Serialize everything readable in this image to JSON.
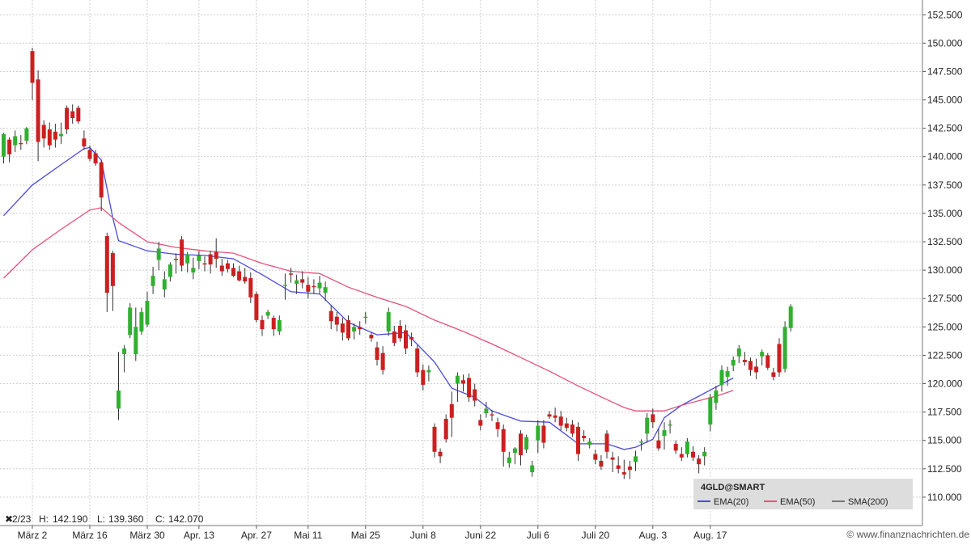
{
  "chart_data": {
    "type": "candlestick",
    "symbol": "4GLD@SMART",
    "info_line": {
      "prefix": "2/23",
      "high_label": "H:",
      "high": "142.190",
      "low_label": "L:",
      "low": "139.360",
      "close_label": "C:",
      "close": "142.070"
    },
    "y_axis": {
      "min": 107.5,
      "max": 153.8,
      "ticks": [
        "152.500",
        "150.000",
        "147.500",
        "145.000",
        "142.500",
        "140.000",
        "137.500",
        "135.000",
        "132.500",
        "130.000",
        "127.500",
        "125.000",
        "122.500",
        "120.000",
        "117.500",
        "115.000",
        "112.500",
        "110.000"
      ]
    },
    "x_ticks": [
      {
        "label": "März 2",
        "index": 5
      },
      {
        "label": "März 16",
        "index": 15
      },
      {
        "label": "März 30",
        "index": 25
      },
      {
        "label": "Apr. 13",
        "index": 34
      },
      {
        "label": "Apr. 27",
        "index": 44
      },
      {
        "label": "Mai 11",
        "index": 53
      },
      {
        "label": "Mai 25",
        "index": 63
      },
      {
        "label": "Juni 8",
        "index": 73
      },
      {
        "label": "Juni 22",
        "index": 83
      },
      {
        "label": "Juli 6",
        "index": 93
      },
      {
        "label": "Juli 20",
        "index": 103
      },
      {
        "label": "Aug. 3",
        "index": 113
      },
      {
        "label": "Aug. 17",
        "index": 123
      }
    ],
    "candles": [
      [
        140.0,
        142.1,
        139.4,
        142.0
      ],
      [
        141.5,
        141.7,
        139.5,
        140.2
      ],
      [
        141.0,
        142.3,
        140.4,
        141.8
      ],
      [
        141.2,
        141.9,
        140.6,
        141.1
      ],
      [
        141.4,
        142.6,
        141.1,
        142.5
      ],
      [
        149.3,
        149.6,
        145.0,
        146.5
      ],
      [
        146.8,
        147.6,
        139.6,
        141.3
      ],
      [
        142.8,
        143.2,
        140.8,
        141.6
      ],
      [
        142.4,
        143.0,
        140.6,
        141.0
      ],
      [
        142.2,
        142.9,
        140.8,
        141.5
      ],
      [
        141.8,
        143.0,
        141.1,
        142.0
      ],
      [
        144.3,
        144.5,
        142.0,
        142.4
      ],
      [
        144.0,
        144.6,
        142.9,
        143.4
      ],
      [
        144.3,
        144.5,
        142.9,
        143.1
      ],
      [
        141.6,
        142.3,
        140.6,
        140.9
      ],
      [
        140.6,
        141.0,
        139.6,
        139.8
      ],
      [
        140.3,
        140.6,
        139.2,
        139.4
      ],
      [
        139.5,
        139.7,
        135.2,
        136.4
      ],
      [
        133.0,
        133.3,
        126.3,
        128.0
      ],
      [
        131.5,
        131.7,
        126.4,
        128.6
      ],
      [
        117.8,
        122.8,
        116.8,
        119.4
      ],
      [
        122.6,
        123.4,
        121.0,
        123.1
      ],
      [
        124.3,
        127.1,
        124.0,
        126.7
      ],
      [
        122.6,
        126.7,
        122.0,
        125.0
      ],
      [
        124.6,
        126.7,
        124.3,
        126.3
      ],
      [
        125.2,
        128.1,
        125.0,
        127.3
      ],
      [
        128.6,
        130.3,
        127.9,
        129.5
      ],
      [
        130.9,
        132.5,
        130.0,
        131.9
      ],
      [
        128.3,
        129.9,
        127.6,
        129.2
      ],
      [
        129.4,
        130.7,
        129.0,
        130.5
      ],
      [
        131.0,
        131.5,
        129.7,
        130.9
      ],
      [
        132.7,
        133.0,
        129.9,
        130.4
      ],
      [
        130.6,
        131.6,
        129.8,
        131.4
      ],
      [
        129.8,
        131.1,
        129.2,
        130.2
      ],
      [
        130.8,
        131.7,
        130.1,
        131.3
      ],
      [
        130.6,
        131.2,
        129.9,
        130.5
      ],
      [
        131.4,
        131.7,
        129.7,
        130.5
      ],
      [
        131.6,
        132.8,
        130.2,
        131.0
      ],
      [
        130.4,
        131.0,
        129.5,
        129.9
      ],
      [
        130.6,
        130.9,
        129.8,
        130.1
      ],
      [
        130.2,
        130.6,
        129.4,
        129.5
      ],
      [
        129.9,
        130.4,
        129.0,
        129.1
      ],
      [
        129.4,
        130.2,
        128.8,
        129.0
      ],
      [
        129.3,
        129.8,
        127.1,
        127.6
      ],
      [
        127.9,
        128.1,
        125.4,
        125.6
      ],
      [
        125.6,
        126.0,
        124.2,
        124.8
      ],
      [
        126.0,
        126.5,
        125.7,
        126.3
      ],
      [
        125.8,
        126.0,
        124.2,
        124.8
      ],
      [
        124.6,
        126.0,
        124.3,
        125.6
      ],
      [
        128.6,
        129.7,
        127.4,
        128.7
      ],
      [
        129.7,
        130.2,
        128.9,
        129.6
      ],
      [
        128.8,
        129.6,
        127.9,
        129.1
      ],
      [
        129.2,
        129.9,
        128.4,
        128.9
      ],
      [
        128.7,
        129.4,
        127.5,
        128.1
      ],
      [
        128.6,
        129.2,
        127.9,
        128.5
      ],
      [
        128.4,
        129.5,
        127.9,
        128.9
      ],
      [
        128.0,
        129.0,
        127.3,
        128.5
      ],
      [
        126.4,
        126.9,
        124.8,
        125.5
      ],
      [
        125.9,
        126.3,
        124.6,
        125.2
      ],
      [
        125.3,
        125.8,
        123.8,
        124.5
      ],
      [
        125.6,
        126.0,
        123.8,
        124.0
      ],
      [
        124.6,
        125.3,
        123.9,
        125.0
      ],
      [
        125.0,
        125.5,
        124.3,
        124.8
      ],
      [
        125.8,
        126.3,
        125.3,
        125.9
      ],
      [
        124.3,
        124.5,
        123.7,
        124.0
      ],
      [
        123.2,
        123.7,
        121.6,
        122.1
      ],
      [
        122.7,
        123.3,
        120.8,
        121.2
      ],
      [
        124.6,
        126.7,
        124.2,
        126.3
      ],
      [
        124.6,
        125.1,
        123.3,
        123.6
      ],
      [
        125.1,
        125.6,
        123.7,
        124.0
      ],
      [
        124.7,
        125.2,
        122.6,
        123.1
      ],
      [
        124.1,
        124.5,
        123.3,
        123.9
      ],
      [
        123.1,
        123.4,
        120.6,
        121.0
      ],
      [
        121.2,
        121.7,
        119.4,
        119.9
      ],
      [
        121.0,
        121.6,
        120.2,
        121.2
      ],
      [
        116.2,
        116.5,
        113.5,
        114.0
      ],
      [
        114.0,
        114.3,
        113.0,
        113.6
      ],
      [
        116.9,
        117.3,
        114.8,
        115.1
      ],
      [
        118.2,
        119.3,
        115.3,
        117.0
      ],
      [
        120.0,
        121.0,
        118.4,
        120.7
      ],
      [
        120.3,
        120.8,
        119.3,
        120.0
      ],
      [
        120.5,
        120.9,
        118.4,
        118.8
      ],
      [
        119.5,
        120.0,
        118.0,
        118.5
      ],
      [
        116.8,
        117.3,
        115.9,
        116.3
      ],
      [
        117.4,
        118.4,
        117.0,
        117.8
      ],
      [
        117.3,
        117.7,
        116.7,
        117.2
      ],
      [
        116.6,
        117.0,
        115.3,
        116.0
      ],
      [
        116.0,
        116.4,
        112.7,
        114.0
      ],
      [
        113.0,
        114.0,
        112.6,
        113.5
      ],
      [
        113.9,
        114.4,
        112.9,
        114.3
      ],
      [
        115.6,
        115.9,
        112.8,
        113.7
      ],
      [
        114.2,
        115.5,
        113.9,
        115.3
      ],
      [
        112.2,
        113.2,
        111.8,
        112.8
      ],
      [
        115.0,
        116.8,
        113.9,
        116.3
      ],
      [
        116.3,
        116.8,
        114.3,
        114.8
      ],
      [
        117.3,
        117.6,
        116.9,
        117.1
      ],
      [
        117.2,
        117.9,
        116.6,
        117.0
      ],
      [
        117.1,
        117.6,
        115.9,
        116.3
      ],
      [
        116.5,
        117.0,
        115.8,
        116.1
      ],
      [
        116.4,
        116.8,
        115.3,
        115.6
      ],
      [
        116.2,
        116.6,
        113.2,
        113.8
      ],
      [
        115.4,
        115.9,
        114.9,
        115.2
      ],
      [
        114.6,
        115.2,
        114.3,
        114.9
      ],
      [
        113.8,
        114.2,
        112.9,
        113.3
      ],
      [
        113.2,
        113.7,
        112.4,
        112.7
      ],
      [
        115.6,
        115.9,
        113.4,
        114.0
      ],
      [
        113.5,
        114.0,
        112.2,
        113.3
      ],
      [
        112.8,
        113.6,
        112.1,
        112.5
      ],
      [
        112.2,
        113.3,
        111.6,
        112.0
      ],
      [
        112.7,
        113.2,
        111.6,
        112.4
      ],
      [
        113.1,
        114.1,
        112.3,
        113.6
      ],
      [
        114.8,
        115.1,
        114.1,
        114.9
      ],
      [
        115.6,
        117.4,
        114.8,
        117.0
      ],
      [
        117.3,
        117.8,
        116.1,
        116.6
      ],
      [
        115.0,
        116.0,
        114.1,
        114.3
      ],
      [
        115.4,
        116.6,
        114.2,
        115.9
      ],
      [
        116.3,
        116.8,
        115.6,
        116.4
      ],
      [
        114.7,
        115.0,
        113.8,
        114.1
      ],
      [
        113.8,
        114.4,
        113.2,
        113.5
      ],
      [
        113.8,
        115.2,
        113.5,
        114.9
      ],
      [
        114.0,
        114.5,
        113.2,
        113.5
      ],
      [
        113.4,
        113.7,
        112.1,
        112.9
      ],
      [
        113.6,
        114.4,
        112.8,
        114.0
      ],
      [
        116.4,
        119.1,
        115.8,
        118.8
      ],
      [
        118.3,
        119.8,
        117.7,
        119.4
      ],
      [
        119.9,
        121.6,
        119.3,
        121.2
      ],
      [
        120.6,
        121.5,
        119.8,
        121.1
      ],
      [
        121.6,
        122.4,
        121.1,
        122.1
      ],
      [
        122.4,
        123.4,
        121.8,
        123.1
      ],
      [
        122.1,
        122.8,
        121.6,
        121.9
      ],
      [
        122.0,
        122.3,
        120.7,
        121.2
      ],
      [
        121.5,
        122.2,
        120.4,
        121.0
      ],
      [
        122.4,
        123.0,
        121.6,
        122.8
      ],
      [
        122.5,
        122.7,
        121.2,
        121.4
      ],
      [
        121.0,
        121.4,
        120.3,
        120.6
      ],
      [
        123.5,
        124.0,
        120.6,
        121.0
      ],
      [
        121.3,
        125.5,
        121.0,
        125.0
      ],
      [
        124.9,
        127.0,
        124.6,
        126.8
      ]
    ],
    "series": [
      {
        "name": "EMA(20)",
        "color": "#4a4ae0",
        "x": [
          0,
          5,
          10,
          14,
          15,
          17,
          19,
          20,
          25,
          30,
          35,
          40,
          45,
          50,
          55,
          60,
          65,
          70,
          75,
          78,
          82,
          85,
          90,
          95,
          100,
          105,
          108,
          110,
          113,
          115,
          118,
          121,
          124,
          127
        ],
        "values": [
          134.8,
          137.5,
          139.3,
          140.7,
          140.8,
          139.7,
          134.6,
          132.6,
          131.7,
          131.4,
          131.3,
          131.0,
          129.6,
          128.1,
          127.9,
          125.4,
          124.3,
          124.5,
          121.9,
          119.6,
          118.8,
          117.6,
          116.7,
          116.6,
          114.7,
          114.7,
          114.2,
          114.4,
          115.1,
          117.0,
          118.1,
          118.9,
          119.7,
          120.5
        ]
      },
      {
        "name": "EMA(50)",
        "color": "#e8507a",
        "x": [
          0,
          5,
          10,
          15,
          17,
          20,
          25,
          30,
          35,
          40,
          45,
          50,
          55,
          60,
          65,
          70,
          75,
          80,
          85,
          90,
          95,
          100,
          105,
          108,
          110,
          112,
          115,
          118,
          121,
          124,
          127
        ],
        "values": [
          129.3,
          131.8,
          133.6,
          135.3,
          135.5,
          134.2,
          132.5,
          132.0,
          131.7,
          131.5,
          130.6,
          129.9,
          129.7,
          128.5,
          127.6,
          126.8,
          125.6,
          124.6,
          123.5,
          122.3,
          121.1,
          119.8,
          118.6,
          117.9,
          117.6,
          117.6,
          117.6,
          118.1,
          118.5,
          118.9,
          119.4
        ]
      }
    ],
    "legend": {
      "symbol": "4GLD@SMART",
      "items": [
        {
          "label": "EMA(20)",
          "color": "#4a4ae0"
        },
        {
          "label": "EMA(50)",
          "color": "#e8507a"
        },
        {
          "label": "SMA(200)",
          "color": "#777777"
        }
      ]
    },
    "colors": {
      "up": "#30b030",
      "down": "#cc1f1f",
      "grid": "#cfcfcf"
    },
    "watermark": "© www.finanznachrichten.de"
  }
}
